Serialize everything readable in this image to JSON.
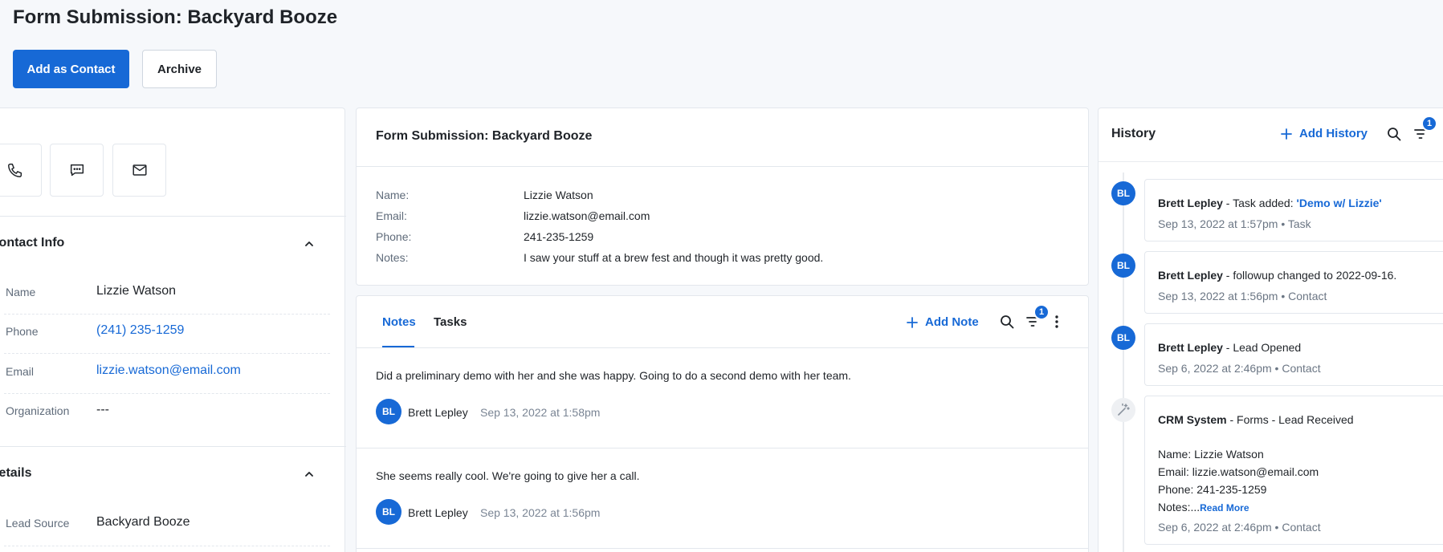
{
  "header": {
    "title": "Form Submission: Backyard Booze",
    "add_contact_label": "Add as Contact",
    "archive_label": "Archive"
  },
  "left_panel": {
    "actions": [
      "phone-icon",
      "chat-icon",
      "mail-icon"
    ],
    "contact_info": {
      "title": "Contact Info",
      "fields": [
        {
          "label": "Name",
          "value": "Lizzie Watson"
        },
        {
          "label": "Phone",
          "value": "(241) 235-1259"
        },
        {
          "label": "Email",
          "value": "lizzie.watson@email.com"
        },
        {
          "label": "Organization",
          "value": "---"
        }
      ]
    },
    "details": {
      "title": "Details",
      "fields": [
        {
          "label": "Lead Source",
          "value": "Backyard Booze"
        }
      ]
    }
  },
  "submission": {
    "title": "Form Submission: Backyard Booze",
    "rows": [
      {
        "label": "Name:",
        "value": "Lizzie Watson"
      },
      {
        "label": "Email:",
        "value": "lizzie.watson@email.com"
      },
      {
        "label": "Phone:",
        "value": "241-235-1259"
      },
      {
        "label": "Notes:",
        "value": "I saw your stuff at a brew fest and though it was pretty good."
      }
    ]
  },
  "notes_panel": {
    "tabs": [
      "Notes",
      "Tasks"
    ],
    "active_tab": "Notes",
    "add_label": "Add Note",
    "filter_count": "1",
    "notes": [
      {
        "text": "Did a preliminary demo with her and she was happy. Going to do a second demo with her team.",
        "initials": "BL",
        "author": "Brett Lepley",
        "time": "Sep 13, 2022 at 1:58pm"
      },
      {
        "text": "She seems really cool. We're going to give her a call.",
        "initials": "BL",
        "author": "Brett Lepley",
        "time": "Sep 13, 2022 at 1:56pm"
      }
    ]
  },
  "history": {
    "title": "History",
    "add_label": "Add History",
    "filter_count": "1",
    "items": [
      {
        "initials": "BL",
        "author": "Brett Lepley",
        "action": " - Task added: ",
        "link": "'Demo w/ Lizzie'",
        "meta": "Sep 13, 2022 at 1:57pm • Task"
      },
      {
        "initials": "BL",
        "author": "Brett Lepley",
        "action": " - followup changed to 2022-09-16.",
        "link": "",
        "meta": "Sep 13, 2022 at 1:56pm • Contact"
      },
      {
        "initials": "BL",
        "author": "Brett Lepley",
        "action": " - Lead Opened",
        "link": "",
        "meta": "Sep 6, 2022 at 2:46pm • Contact"
      },
      {
        "initials": "",
        "author": "CRM System",
        "action": " - Forms - Lead Received",
        "link": "",
        "details": [
          "Name: Lizzie Watson",
          "Email: lizzie.watson@email.com",
          "Phone: 241-235-1259"
        ],
        "notes_prefix": "Notes:...",
        "read_more": "Read More",
        "meta": "Sep 6, 2022 at 2:46pm • Contact"
      }
    ]
  }
}
